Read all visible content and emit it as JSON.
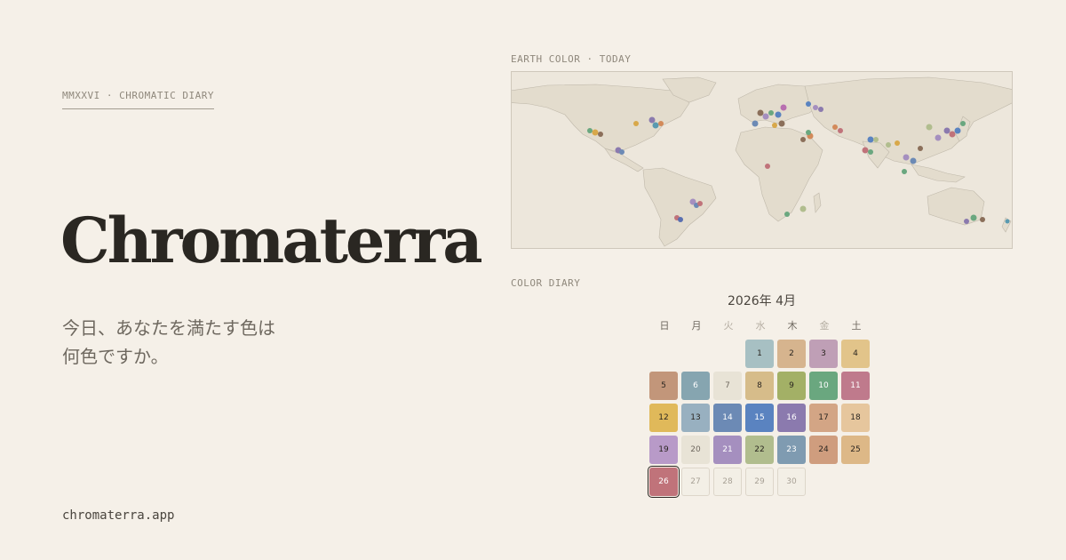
{
  "header": {
    "eyebrow": "MMXXVI  ·  CHROMATIC DIARY",
    "brand": "Chromaterra",
    "tagline_line1": "今日、あなたを満たす色は",
    "tagline_line2": "何色ですか。",
    "url": "chromaterra.app"
  },
  "map": {
    "label": "EARTH COLOR  ·  TODAY"
  },
  "diary": {
    "label": "COLOR DIARY",
    "month_title": "2026年 4月",
    "weekdays": [
      "日",
      "月",
      "火",
      "水",
      "木",
      "金",
      "土"
    ],
    "days": [
      {
        "day": "1",
        "color": "#a7c0c3",
        "text": "#2a2520"
      },
      {
        "day": "2",
        "color": "#d6b48e",
        "text": "#2a2520"
      },
      {
        "day": "3",
        "color": "#bf9fb6",
        "text": "#2a2520"
      },
      {
        "day": "4",
        "color": "#e2c48a",
        "text": "#2a2520"
      },
      {
        "day": "5",
        "color": "#c2967a",
        "text": "#2a2520"
      },
      {
        "day": "6",
        "color": "#86a5b0",
        "text": "#ffffff"
      },
      {
        "day": "7",
        "color": "#e8e3d6",
        "text": "#6e685f"
      },
      {
        "day": "8",
        "color": "#d6bc8a",
        "text": "#2a2520"
      },
      {
        "day": "9",
        "color": "#a3b066",
        "text": "#2a2520"
      },
      {
        "day": "10",
        "color": "#6aa77f",
        "text": "#ffffff"
      },
      {
        "day": "11",
        "color": "#bf7a8c",
        "text": "#ffffff"
      },
      {
        "day": "12",
        "color": "#e0b95a",
        "text": "#2a2520"
      },
      {
        "day": "13",
        "color": "#98b0c0",
        "text": "#2a2520"
      },
      {
        "day": "14",
        "color": "#6c8ab5",
        "text": "#ffffff"
      },
      {
        "day": "15",
        "color": "#5a83c0",
        "text": "#ffffff"
      },
      {
        "day": "16",
        "color": "#8b7aae",
        "text": "#ffffff"
      },
      {
        "day": "17",
        "color": "#d3a585",
        "text": "#2a2520"
      },
      {
        "day": "18",
        "color": "#e6c69d",
        "text": "#2a2520"
      },
      {
        "day": "19",
        "color": "#b89ac8",
        "text": "#2a2520"
      },
      {
        "day": "20",
        "color": "#e8e3d6",
        "text": "#6e685f"
      },
      {
        "day": "21",
        "color": "#a58fbf",
        "text": "#ffffff"
      },
      {
        "day": "22",
        "color": "#b1bd8e",
        "text": "#2a2520"
      },
      {
        "day": "23",
        "color": "#7f9bb1",
        "text": "#ffffff"
      },
      {
        "day": "24",
        "color": "#cf9d7e",
        "text": "#2a2520"
      },
      {
        "day": "25",
        "color": "#ddb887",
        "text": "#2a2520"
      },
      {
        "day": "26",
        "color": "#c0737a",
        "text": "#ffffff",
        "today": true
      },
      {
        "day": "27",
        "future": true
      },
      {
        "day": "28",
        "future": true
      },
      {
        "day": "29",
        "future": true
      },
      {
        "day": "30",
        "future": true
      }
    ],
    "first_weekday": 3
  },
  "colors": {
    "background": "#f5f0e8",
    "land": "#e3dccd",
    "ocean": "#ede7dc",
    "border": "#cfc8bb"
  }
}
